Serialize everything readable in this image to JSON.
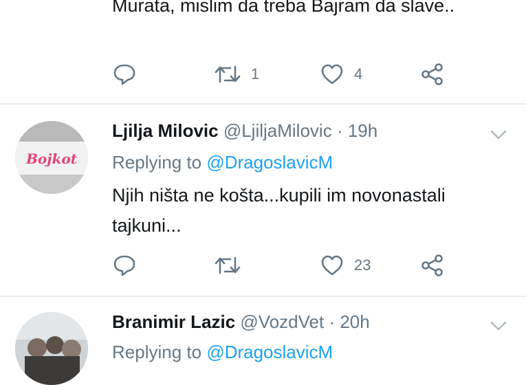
{
  "tweets": [
    {
      "text": "Murata, mislim da treba Bajram da slave..",
      "retweets": "1",
      "likes": "4"
    },
    {
      "name": "Ljilja Milovic",
      "handle": "@LjiljaMilovic",
      "time": "· 19h",
      "replying_prefix": "Replying to ",
      "replying_to": "@DragoslavicM",
      "avatar_text": "Bojkot",
      "text": "Njih ništa ne košta...kupili im novonastali tajkuni...",
      "retweets": "",
      "likes": "23"
    },
    {
      "name": "Branimir Lazic",
      "handle": "@VozdVet",
      "time": "· 20h",
      "replying_prefix": "Replying to ",
      "replying_to": "@DragoslavicM"
    }
  ],
  "icons": {
    "reply": "reply-icon",
    "retweet": "retweet-icon",
    "like": "heart-icon",
    "share": "share-icon",
    "menu": "chevron-down-icon"
  },
  "colors": {
    "name": "#14171a",
    "secondary": "#657786",
    "mention": "#1da1f2",
    "divider": "#e6ecf0"
  }
}
